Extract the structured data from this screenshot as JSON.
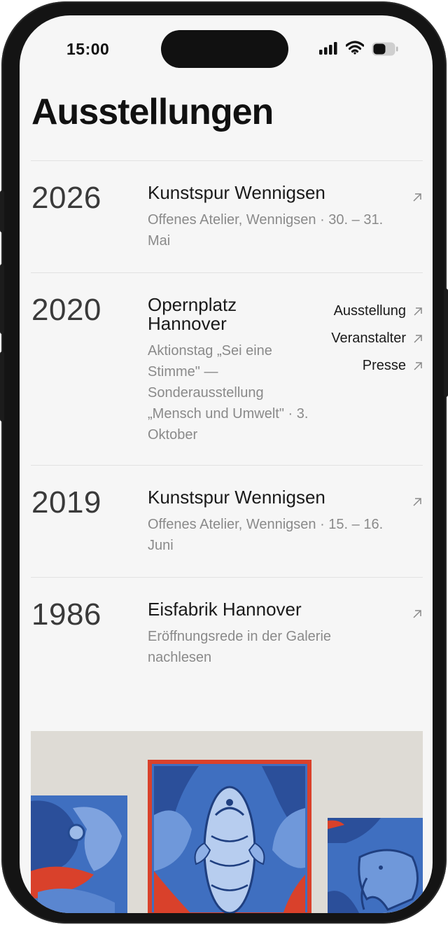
{
  "status_bar": {
    "time": "15:00"
  },
  "page": {
    "title": "Ausstellungen"
  },
  "exhibitions": [
    {
      "year": "2026",
      "name": "Kunstspur Wennigsen",
      "description": "Offenes Atelier, Wennigsen · 30. – 31. Mai"
    },
    {
      "year": "2020",
      "name": "Opernplatz Hannover",
      "description": "Aktionstag „Sei eine Stimme\" — Sonderausstellung „Mensch und Umwelt\" · 3. Oktober",
      "links": [
        "Ausstellung",
        "Veranstalter",
        "Presse"
      ]
    },
    {
      "year": "2019",
      "name": "Kunstspur Wennigsen",
      "description": "Offenes Atelier, Wennigsen · 15. – 16. Juni"
    },
    {
      "year": "1986",
      "name": "Eisfabrik Hannover",
      "description": "Eröffnungsrede in der Galerie nachlesen"
    }
  ],
  "icons": {
    "external": "arrow-up-right-icon"
  },
  "colors": {
    "background": "#f6f6f6",
    "text": "#1a1a1a",
    "muted": "#8a8a8a",
    "painting_blue": "#3f6fc0",
    "painting_red": "#d9412b"
  }
}
